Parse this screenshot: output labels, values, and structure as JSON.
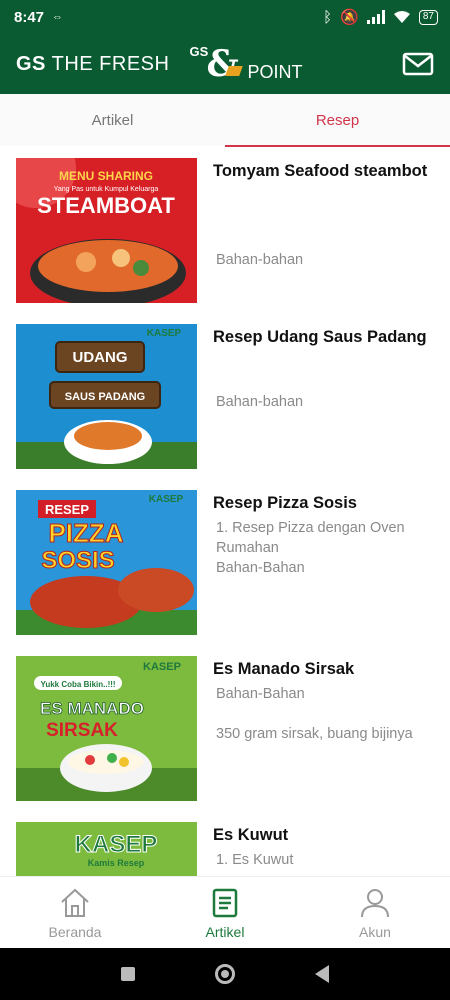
{
  "status_bar": {
    "time": "8:47",
    "battery": "87"
  },
  "header": {
    "brand_bold": "GS",
    "brand_rest": " THE FRESH",
    "point_gs": "GS",
    "point_amp": "&",
    "point_label": "POINT",
    "mail_icon": "mail-icon"
  },
  "tabs": [
    {
      "label": "Artikel"
    },
    {
      "label": "Resep",
      "active": true
    }
  ],
  "recipes": [
    {
      "title": "Tomyam Seafood steambot",
      "lines": [
        "Bahan-bahan"
      ],
      "thumb": {
        "top": "MENU SHARING",
        "sub": "Yang Pas untuk Kumpul Keluarga",
        "main": "STEAMBOAT"
      }
    },
    {
      "title": "Resep Udang Saus Padang",
      "lines": [
        "Bahan-bahan"
      ],
      "thumb": {
        "top": "KASEP",
        "main": "UDANG",
        "main2": "SAUS PADANG"
      }
    },
    {
      "title": "Resep Pizza Sosis",
      "lines": [
        "1. Resep Pizza dengan Oven Rumahan",
        "Bahan-Bahan"
      ],
      "thumb": {
        "top": "RESEP",
        "main": "PIZZA",
        "main2": "SOSIS",
        "badge": "KASEP"
      }
    },
    {
      "title": "Es Manado Sirsak",
      "lines": [
        "Bahan-Bahan",
        "350 gram sirsak, buang bijinya"
      ],
      "thumb": {
        "top": "Yukk Coba Bikin..!!!",
        "main": "ES MANADO",
        "main2": "SIRSAK",
        "badge": "KASEP"
      }
    },
    {
      "title": "Es Kuwut",
      "lines": [
        "1. Es Kuwut"
      ],
      "thumb": {
        "main": "KASEP",
        "main2": "Kamis Resep"
      }
    }
  ],
  "bottom_nav": [
    {
      "label": "Beranda",
      "icon": "home-icon"
    },
    {
      "label": "Artikel",
      "icon": "article-icon",
      "active": true
    },
    {
      "label": "Akun",
      "icon": "user-icon"
    }
  ]
}
